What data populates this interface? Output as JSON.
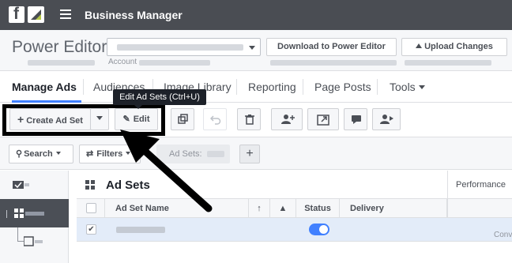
{
  "topbar": {
    "fb_logo": "f",
    "title": "Business Manager",
    "menu_icon": "hamburger-icon"
  },
  "power_editor": {
    "title": "Power Editor",
    "account_label": "Account",
    "download_label": "Download to Power Editor",
    "upload_label": "Upload Changes"
  },
  "tabs": [
    {
      "label": "Manage Ads",
      "active": true
    },
    {
      "label": "Audiences",
      "active": false
    },
    {
      "label": "Image Library",
      "active": false
    },
    {
      "label": "Reporting",
      "active": false
    },
    {
      "label": "Page Posts",
      "active": false
    },
    {
      "label": "Tools",
      "active": false
    }
  ],
  "tooltip": "Edit Ad Sets (Ctrl+U)",
  "toolbar": {
    "create_label": "Create Ad Set",
    "edit_label": "Edit",
    "icons": [
      "duplicate-icon",
      "undo-icon",
      "delete-icon",
      "add-audience-icon",
      "export-icon",
      "comment-icon",
      "share-icon"
    ]
  },
  "filters": {
    "search_label": "Search",
    "filters_label": "Filters",
    "adsets_chip": "Ad Sets:",
    "add_label": "+"
  },
  "table": {
    "title": "Ad Sets",
    "performance_label": "Performance",
    "columns": {
      "name": "Ad Set Name",
      "status": "Status",
      "delivery": "Delivery"
    },
    "row_partial_text": "Conv"
  },
  "colors": {
    "topbar_bg": "#4a4d53",
    "accent": "#4080ff",
    "highlight_border": "#000000",
    "selected_row": "#e3ecf9"
  }
}
